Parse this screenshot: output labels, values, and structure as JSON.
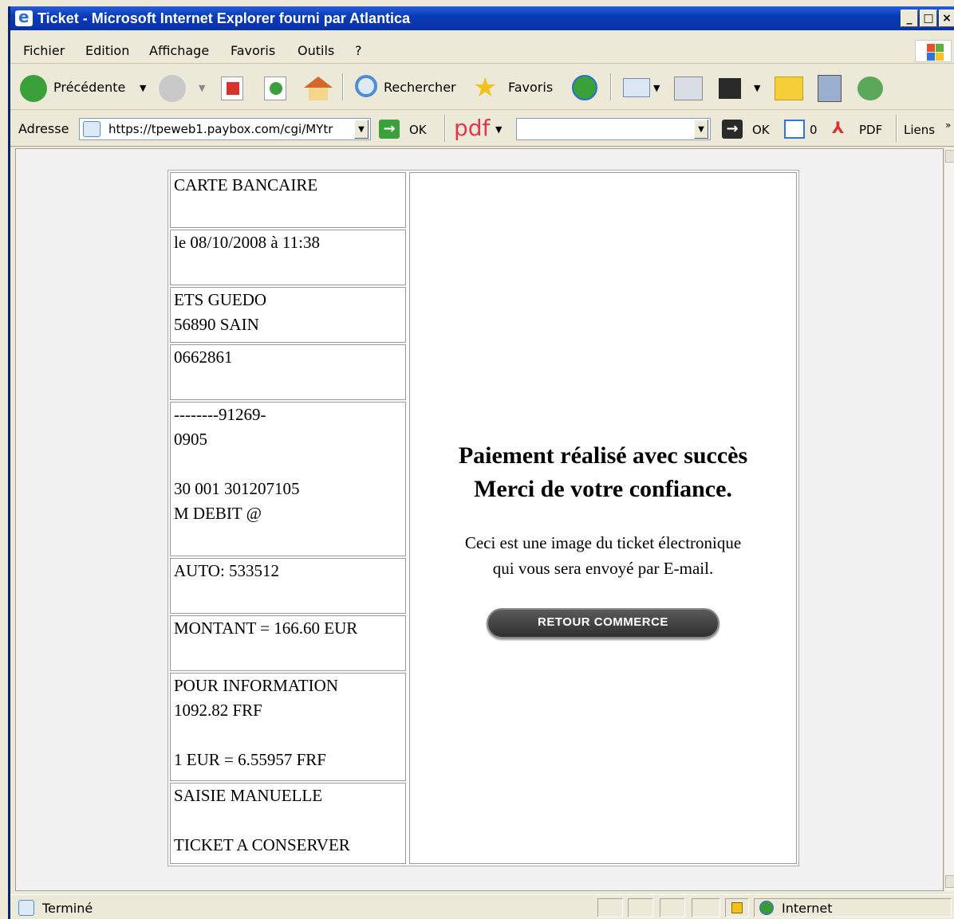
{
  "window": {
    "title": "Ticket - Microsoft Internet Explorer fourni par Atlantica"
  },
  "menu": {
    "items": [
      "Fichier",
      "Edition",
      "Affichage",
      "Favoris",
      "Outils",
      "?"
    ]
  },
  "toolbar": {
    "back_label": "Précédente",
    "search_label": "Rechercher",
    "favorites_label": "Favoris"
  },
  "address": {
    "label": "Adresse",
    "url": "https://tpeweb1.paybox.com/cgi/MYtr",
    "go_label": "OK",
    "pdf_label": "pdf",
    "go2_label": "OK",
    "count": "0",
    "pdf_button_label": "PDF",
    "links_label": "Liens"
  },
  "ticket": {
    "cells": [
      [
        "CARTE BANCAIRE"
      ],
      [
        "le 08/10/2008 à 11:38"
      ],
      [
        "ETS GUEDO",
        "56890 SAIN"
      ],
      [
        "0662861"
      ],
      [
        "--------91269-",
        "0905",
        "",
        "30 001 301207105",
        "M DEBIT @"
      ],
      [
        "AUTO: 533512"
      ],
      [
        "MONTANT = 166.60 EUR"
      ],
      [
        "POUR INFORMATION",
        "1092.82 FRF",
        "",
        "1 EUR = 6.55957 FRF"
      ],
      [
        "SAISIE MANUELLE",
        "",
        "TICKET A CONSERVER"
      ]
    ],
    "success_line1": "Paiement réalisé avec succès",
    "success_line2": "Merci de votre confiance.",
    "info_line1": "Ceci est une image du ticket électronique",
    "info_line2": "qui vous sera envoyé par E-mail.",
    "retour_button": "RETOUR COMMERCE"
  },
  "status": {
    "text": "Terminé",
    "zone": "Internet"
  },
  "colors": {
    "title_bar": "#0a3cb8",
    "button_dark": "#3a3a3a"
  }
}
